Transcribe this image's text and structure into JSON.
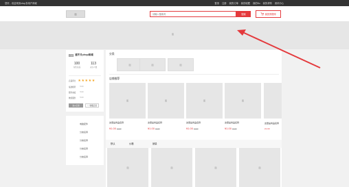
{
  "topbar": {
    "welcome": "您好，欢迎来到shop多用户商城",
    "nav": [
      "登录",
      "注册",
      "我的订单",
      "我的收藏",
      "我的Bu",
      "我的求购",
      "资讯中心"
    ]
  },
  "header": {
    "logo_placeholder": "图",
    "search_placeholder": "请输入搜索词",
    "search_button": "搜索",
    "cart_label": "我的购物车"
  },
  "banner": {
    "placeholder": "图"
  },
  "shop": {
    "badge": "自营",
    "name": "道不凡shop商城",
    "stats": [
      {
        "num": "100",
        "label": "在售商品"
      },
      {
        "num": "113",
        "label": "关注人数"
      }
    ],
    "rating_label": "店铺评分",
    "stars": "★★★★★",
    "scores": [
      {
        "label": "描述相符",
        "value": "5.00"
      },
      {
        "label": "服务态度",
        "value": "5.00"
      },
      {
        "label": "物流服务",
        "value": "5.00"
      }
    ],
    "enter_button": "进入店铺",
    "fav_button": "收藏店铺"
  },
  "categories": {
    "items": [
      "电脑配件",
      "分类名称",
      "分类名称",
      "分类名称",
      "分类名称"
    ]
  },
  "main": {
    "category_title": "分类",
    "category_placeholders": [
      "图",
      "图",
      "图"
    ],
    "recommend_title": "店铺推荐",
    "products": [
      {
        "name": "这里是商品名称",
        "price": "¥1.00",
        "oprice": "¥1.00"
      },
      {
        "name": "这里是商品名称",
        "price": "¥1.00",
        "oprice": "¥1.00"
      },
      {
        "name": "这里是商品名称",
        "price": "¥1.00",
        "oprice": "¥1.00"
      },
      {
        "name": "这里是商品名称",
        "price": "¥1.00",
        "oprice": "¥1.00"
      },
      {
        "name": "这里是商品名称",
        "price": "¥1.00",
        "oprice": "¥1.00"
      }
    ],
    "img_placeholder": "图",
    "sort_tabs": [
      "默认",
      "价格",
      "销量"
    ],
    "grid_placeholders": [
      "图",
      "图",
      "图",
      "图"
    ]
  },
  "colors": {
    "accent": "#e4393c",
    "topbar": "#333333",
    "star": "#f5a623"
  }
}
